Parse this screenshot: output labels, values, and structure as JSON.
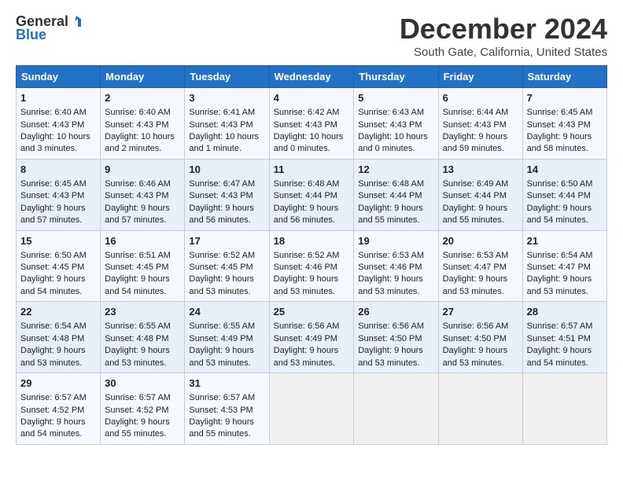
{
  "logo": {
    "line1": "General",
    "line2": "Blue"
  },
  "title": "December 2024",
  "subtitle": "South Gate, California, United States",
  "days_of_week": [
    "Sunday",
    "Monday",
    "Tuesday",
    "Wednesday",
    "Thursday",
    "Friday",
    "Saturday"
  ],
  "weeks": [
    [
      {
        "day": "1",
        "sunrise": "6:40 AM",
        "sunset": "4:43 PM",
        "daylight": "10 hours and 3 minutes."
      },
      {
        "day": "2",
        "sunrise": "6:40 AM",
        "sunset": "4:43 PM",
        "daylight": "10 hours and 2 minutes."
      },
      {
        "day": "3",
        "sunrise": "6:41 AM",
        "sunset": "4:43 PM",
        "daylight": "10 hours and 1 minute."
      },
      {
        "day": "4",
        "sunrise": "6:42 AM",
        "sunset": "4:43 PM",
        "daylight": "10 hours and 0 minutes."
      },
      {
        "day": "5",
        "sunrise": "6:43 AM",
        "sunset": "4:43 PM",
        "daylight": "10 hours and 0 minutes."
      },
      {
        "day": "6",
        "sunrise": "6:44 AM",
        "sunset": "4:43 PM",
        "daylight": "9 hours and 59 minutes."
      },
      {
        "day": "7",
        "sunrise": "6:45 AM",
        "sunset": "4:43 PM",
        "daylight": "9 hours and 58 minutes."
      }
    ],
    [
      {
        "day": "8",
        "sunrise": "6:45 AM",
        "sunset": "4:43 PM",
        "daylight": "9 hours and 57 minutes."
      },
      {
        "day": "9",
        "sunrise": "6:46 AM",
        "sunset": "4:43 PM",
        "daylight": "9 hours and 57 minutes."
      },
      {
        "day": "10",
        "sunrise": "6:47 AM",
        "sunset": "4:43 PM",
        "daylight": "9 hours and 56 minutes."
      },
      {
        "day": "11",
        "sunrise": "6:48 AM",
        "sunset": "4:44 PM",
        "daylight": "9 hours and 56 minutes."
      },
      {
        "day": "12",
        "sunrise": "6:48 AM",
        "sunset": "4:44 PM",
        "daylight": "9 hours and 55 minutes."
      },
      {
        "day": "13",
        "sunrise": "6:49 AM",
        "sunset": "4:44 PM",
        "daylight": "9 hours and 55 minutes."
      },
      {
        "day": "14",
        "sunrise": "6:50 AM",
        "sunset": "4:44 PM",
        "daylight": "9 hours and 54 minutes."
      }
    ],
    [
      {
        "day": "15",
        "sunrise": "6:50 AM",
        "sunset": "4:45 PM",
        "daylight": "9 hours and 54 minutes."
      },
      {
        "day": "16",
        "sunrise": "6:51 AM",
        "sunset": "4:45 PM",
        "daylight": "9 hours and 54 minutes."
      },
      {
        "day": "17",
        "sunrise": "6:52 AM",
        "sunset": "4:45 PM",
        "daylight": "9 hours and 53 minutes."
      },
      {
        "day": "18",
        "sunrise": "6:52 AM",
        "sunset": "4:46 PM",
        "daylight": "9 hours and 53 minutes."
      },
      {
        "day": "19",
        "sunrise": "6:53 AM",
        "sunset": "4:46 PM",
        "daylight": "9 hours and 53 minutes."
      },
      {
        "day": "20",
        "sunrise": "6:53 AM",
        "sunset": "4:47 PM",
        "daylight": "9 hours and 53 minutes."
      },
      {
        "day": "21",
        "sunrise": "6:54 AM",
        "sunset": "4:47 PM",
        "daylight": "9 hours and 53 minutes."
      }
    ],
    [
      {
        "day": "22",
        "sunrise": "6:54 AM",
        "sunset": "4:48 PM",
        "daylight": "9 hours and 53 minutes."
      },
      {
        "day": "23",
        "sunrise": "6:55 AM",
        "sunset": "4:48 PM",
        "daylight": "9 hours and 53 minutes."
      },
      {
        "day": "24",
        "sunrise": "6:55 AM",
        "sunset": "4:49 PM",
        "daylight": "9 hours and 53 minutes."
      },
      {
        "day": "25",
        "sunrise": "6:56 AM",
        "sunset": "4:49 PM",
        "daylight": "9 hours and 53 minutes."
      },
      {
        "day": "26",
        "sunrise": "6:56 AM",
        "sunset": "4:50 PM",
        "daylight": "9 hours and 53 minutes."
      },
      {
        "day": "27",
        "sunrise": "6:56 AM",
        "sunset": "4:50 PM",
        "daylight": "9 hours and 53 minutes."
      },
      {
        "day": "28",
        "sunrise": "6:57 AM",
        "sunset": "4:51 PM",
        "daylight": "9 hours and 54 minutes."
      }
    ],
    [
      {
        "day": "29",
        "sunrise": "6:57 AM",
        "sunset": "4:52 PM",
        "daylight": "9 hours and 54 minutes."
      },
      {
        "day": "30",
        "sunrise": "6:57 AM",
        "sunset": "4:52 PM",
        "daylight": "9 hours and 55 minutes."
      },
      {
        "day": "31",
        "sunrise": "6:57 AM",
        "sunset": "4:53 PM",
        "daylight": "9 hours and 55 minutes."
      },
      null,
      null,
      null,
      null
    ]
  ],
  "labels": {
    "sunrise_prefix": "Sunrise: ",
    "sunset_prefix": "Sunset: ",
    "daylight_prefix": "Daylight: "
  }
}
